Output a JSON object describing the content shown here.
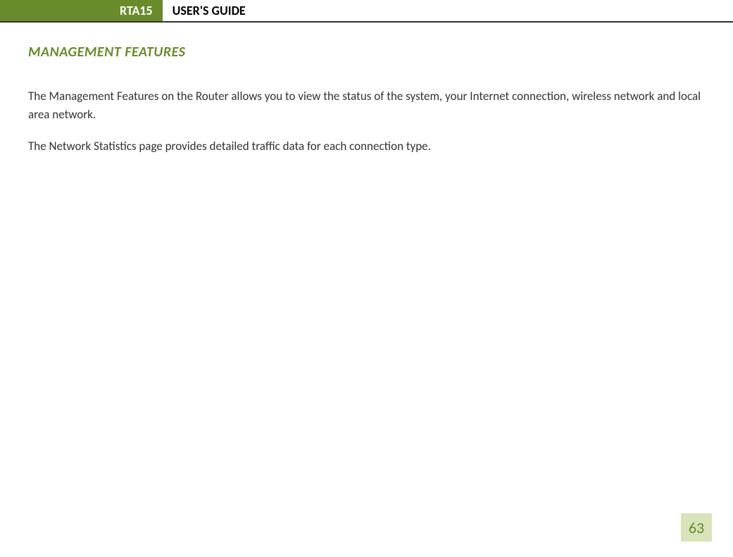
{
  "header": {
    "badge": "RTA15",
    "title": "USER'S GUIDE"
  },
  "section": {
    "heading": "MANAGEMENT FEATURES"
  },
  "paragraphs": {
    "p1": "The Management Features on the Router allows you to view the status of the system, your Internet connection, wireless network and local area network.",
    "p2": "The Network Statistics page provides detailed traffic data for each connection type."
  },
  "page_number": "63"
}
